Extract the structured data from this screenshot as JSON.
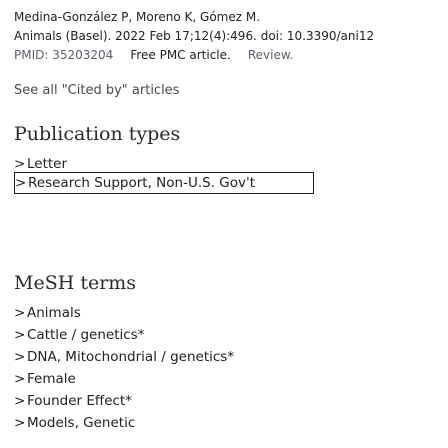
{
  "citation": {
    "top_line": "Medina-González P, Moreno K, Gómez M.",
    "authors": "Medina-González P, Moreno K, Gómez M.",
    "journal": "Animals (Basel). 2022 Feb 17;12(4):496. doi: 10.3390/ani12",
    "pmid": "PMID: 35203204",
    "free_pmc": "Free PMC article.",
    "review": "Review."
  },
  "see_all": "See all \"Cited by\" articles",
  "publication_types": {
    "title": "Publication types",
    "items": [
      {
        "label": "Letter"
      },
      {
        "label": "Research Support, Non-U.S. Gov't"
      }
    ]
  },
  "mesh_terms": {
    "title": "MeSH terms",
    "items": [
      {
        "label": "Animals"
      },
      {
        "label": "Cattle / genetics*"
      },
      {
        "label": "DNA, Mitochondrial / genetics*"
      },
      {
        "label": "Female"
      },
      {
        "label": "Founder Effect*"
      },
      {
        "label": "Models, Genetic"
      }
    ]
  },
  "icons": {
    "chevron": ">"
  }
}
